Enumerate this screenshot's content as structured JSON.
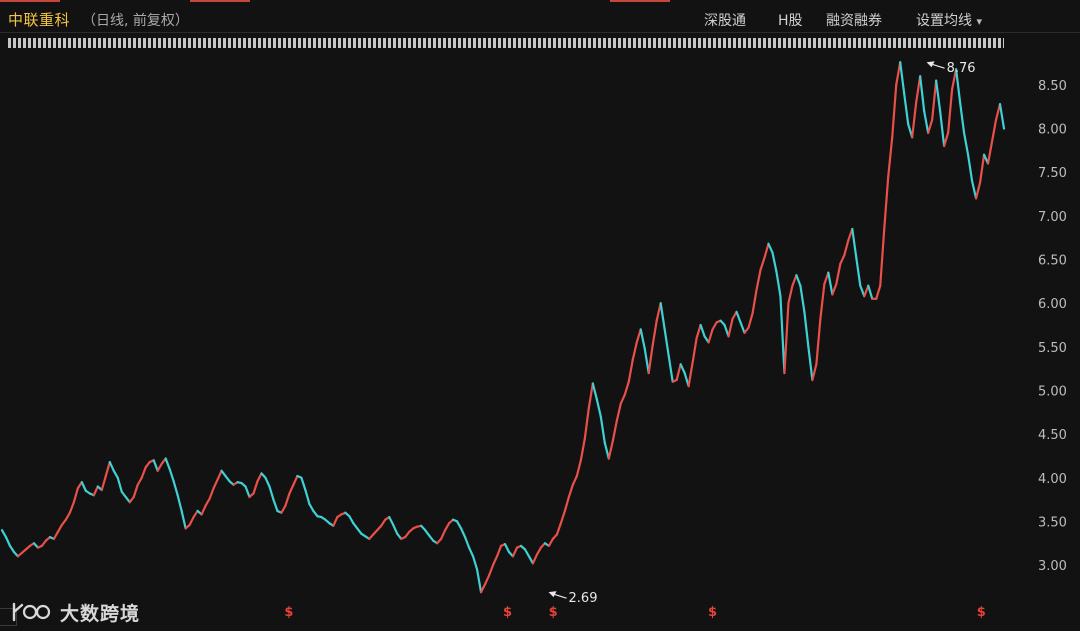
{
  "header": {
    "stock_name": "中联重科",
    "mode": "（日线, 前复权）",
    "buttons": [
      "深股通",
      "H股",
      "融资融券",
      "设置均线"
    ],
    "dropdown_arrow": "▾",
    "accent_color": "#c6463b"
  },
  "watermark": {
    "logo_name": "logo-mark"
  },
  "chart_data": {
    "type": "line",
    "price_axis": {
      "ticks": [
        3.0,
        3.5,
        4.0,
        4.5,
        5.0,
        5.5,
        6.0,
        6.5,
        7.0,
        7.5,
        8.0,
        8.5
      ],
      "tick_labels": [
        "3.00",
        "3.50",
        "4.00",
        "4.50",
        "5.00",
        "5.50",
        "6.00",
        "6.50",
        "7.00",
        "7.50",
        "8.00",
        "8.50"
      ],
      "range": [
        2.6,
        8.9
      ]
    },
    "x_range": [
      0,
      220
    ],
    "annotations": [
      {
        "label": "2.69",
        "value": 2.69,
        "x": 120
      },
      {
        "label": "8.76",
        "value": 8.76,
        "x": 203
      }
    ],
    "dividend_markers": {
      "symbol": "$",
      "positions": [
        63,
        111,
        121,
        156,
        215
      ]
    },
    "colors": {
      "up": "#e8504a",
      "down": "#3fd0d3",
      "axis_text": "#bdbdbd",
      "marker": "#e8413a"
    },
    "series": [
      {
        "values": [
          3.4,
          3.32,
          3.22,
          3.15,
          3.1,
          3.14,
          3.18,
          3.22,
          3.25,
          3.2,
          3.22,
          3.28,
          3.32,
          3.3,
          3.38,
          3.46,
          3.52,
          3.6,
          3.72,
          3.88,
          3.95,
          3.85,
          3.82,
          3.8,
          3.9,
          3.86,
          4.02,
          4.18,
          4.08,
          4.0,
          3.84,
          3.78,
          3.72,
          3.78,
          3.92,
          4.0,
          4.12,
          4.18,
          4.2,
          4.08,
          4.16,
          4.22,
          4.1,
          3.96,
          3.8,
          3.62,
          3.42,
          3.46,
          3.55,
          3.62,
          3.58,
          3.68,
          3.76,
          3.88,
          3.98,
          4.08,
          4.02,
          3.96,
          3.92,
          3.95,
          3.94,
          3.9,
          3.78,
          3.82,
          3.96,
          4.05,
          4.0,
          3.9,
          3.75,
          3.62,
          3.6,
          3.68,
          3.82,
          3.92,
          4.02,
          4.0,
          3.86,
          3.7,
          3.62,
          3.56,
          3.55,
          3.52,
          3.48,
          3.45,
          3.55,
          3.58,
          3.6,
          3.56,
          3.48,
          3.42,
          3.36,
          3.33,
          3.3,
          3.35,
          3.4,
          3.45,
          3.52,
          3.55,
          3.46,
          3.36,
          3.3,
          3.32,
          3.38,
          3.42,
          3.44,
          3.45,
          3.4,
          3.34,
          3.28,
          3.25,
          3.3,
          3.4,
          3.48,
          3.52,
          3.5,
          3.42,
          3.32,
          3.2,
          3.1,
          2.95,
          2.69,
          2.78,
          2.88,
          3.0,
          3.1,
          3.22,
          3.24,
          3.15,
          3.1,
          3.2,
          3.22,
          3.18,
          3.1,
          3.02,
          3.12,
          3.2,
          3.25,
          3.22,
          3.3,
          3.35,
          3.48,
          3.62,
          3.78,
          3.92,
          4.02,
          4.2,
          4.45,
          4.8,
          5.08,
          4.9,
          4.7,
          4.4,
          4.22,
          4.42,
          4.65,
          4.85,
          4.95,
          5.1,
          5.35,
          5.55,
          5.7,
          5.48,
          5.2,
          5.52,
          5.8,
          6.0,
          5.7,
          5.4,
          5.1,
          5.12,
          5.3,
          5.2,
          5.05,
          5.32,
          5.6,
          5.75,
          5.62,
          5.55,
          5.7,
          5.78,
          5.8,
          5.75,
          5.62,
          5.82,
          5.9,
          5.78,
          5.66,
          5.72,
          5.88,
          6.15,
          6.38,
          6.52,
          6.68,
          6.58,
          6.36,
          6.08,
          5.2,
          6.0,
          6.2,
          6.32,
          6.2,
          5.9,
          5.5,
          5.12,
          5.3,
          5.82,
          6.22,
          6.35,
          6.1,
          6.22,
          6.45,
          6.55,
          6.72,
          6.85,
          6.52,
          6.2,
          6.08,
          6.2,
          6.05,
          6.05,
          6.2,
          6.85,
          7.45,
          7.9,
          8.5,
          8.76,
          8.4,
          8.05,
          7.9,
          8.3,
          8.6,
          8.2,
          7.95,
          8.1,
          8.55,
          8.2,
          7.8,
          7.95,
          8.45,
          8.68,
          8.3,
          7.95,
          7.7,
          7.4,
          7.2,
          7.38,
          7.7,
          7.6,
          7.85,
          8.1,
          8.28,
          8.0
        ]
      }
    ]
  }
}
